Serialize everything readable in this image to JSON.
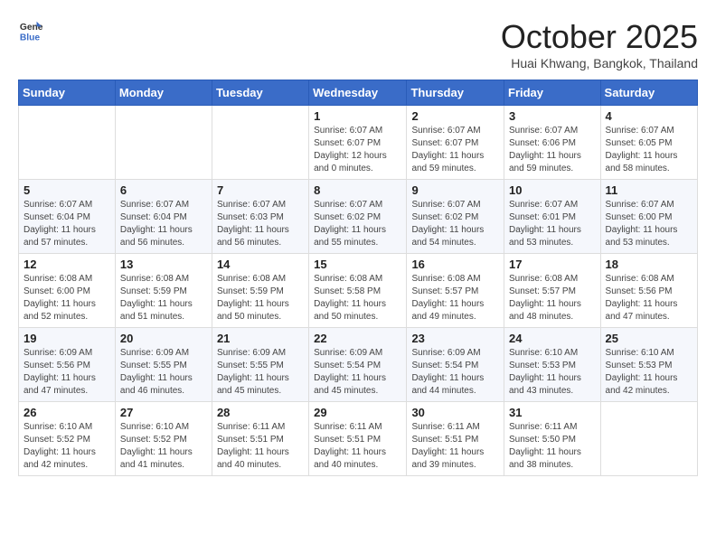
{
  "header": {
    "logo_general": "General",
    "logo_blue": "Blue",
    "month": "October 2025",
    "location": "Huai Khwang, Bangkok, Thailand"
  },
  "weekdays": [
    "Sunday",
    "Monday",
    "Tuesday",
    "Wednesday",
    "Thursday",
    "Friday",
    "Saturday"
  ],
  "weeks": [
    [
      {
        "day": "",
        "info": ""
      },
      {
        "day": "",
        "info": ""
      },
      {
        "day": "",
        "info": ""
      },
      {
        "day": "1",
        "info": "Sunrise: 6:07 AM\nSunset: 6:07 PM\nDaylight: 12 hours\nand 0 minutes."
      },
      {
        "day": "2",
        "info": "Sunrise: 6:07 AM\nSunset: 6:07 PM\nDaylight: 11 hours\nand 59 minutes."
      },
      {
        "day": "3",
        "info": "Sunrise: 6:07 AM\nSunset: 6:06 PM\nDaylight: 11 hours\nand 59 minutes."
      },
      {
        "day": "4",
        "info": "Sunrise: 6:07 AM\nSunset: 6:05 PM\nDaylight: 11 hours\nand 58 minutes."
      }
    ],
    [
      {
        "day": "5",
        "info": "Sunrise: 6:07 AM\nSunset: 6:04 PM\nDaylight: 11 hours\nand 57 minutes."
      },
      {
        "day": "6",
        "info": "Sunrise: 6:07 AM\nSunset: 6:04 PM\nDaylight: 11 hours\nand 56 minutes."
      },
      {
        "day": "7",
        "info": "Sunrise: 6:07 AM\nSunset: 6:03 PM\nDaylight: 11 hours\nand 56 minutes."
      },
      {
        "day": "8",
        "info": "Sunrise: 6:07 AM\nSunset: 6:02 PM\nDaylight: 11 hours\nand 55 minutes."
      },
      {
        "day": "9",
        "info": "Sunrise: 6:07 AM\nSunset: 6:02 PM\nDaylight: 11 hours\nand 54 minutes."
      },
      {
        "day": "10",
        "info": "Sunrise: 6:07 AM\nSunset: 6:01 PM\nDaylight: 11 hours\nand 53 minutes."
      },
      {
        "day": "11",
        "info": "Sunrise: 6:07 AM\nSunset: 6:00 PM\nDaylight: 11 hours\nand 53 minutes."
      }
    ],
    [
      {
        "day": "12",
        "info": "Sunrise: 6:08 AM\nSunset: 6:00 PM\nDaylight: 11 hours\nand 52 minutes."
      },
      {
        "day": "13",
        "info": "Sunrise: 6:08 AM\nSunset: 5:59 PM\nDaylight: 11 hours\nand 51 minutes."
      },
      {
        "day": "14",
        "info": "Sunrise: 6:08 AM\nSunset: 5:59 PM\nDaylight: 11 hours\nand 50 minutes."
      },
      {
        "day": "15",
        "info": "Sunrise: 6:08 AM\nSunset: 5:58 PM\nDaylight: 11 hours\nand 50 minutes."
      },
      {
        "day": "16",
        "info": "Sunrise: 6:08 AM\nSunset: 5:57 PM\nDaylight: 11 hours\nand 49 minutes."
      },
      {
        "day": "17",
        "info": "Sunrise: 6:08 AM\nSunset: 5:57 PM\nDaylight: 11 hours\nand 48 minutes."
      },
      {
        "day": "18",
        "info": "Sunrise: 6:08 AM\nSunset: 5:56 PM\nDaylight: 11 hours\nand 47 minutes."
      }
    ],
    [
      {
        "day": "19",
        "info": "Sunrise: 6:09 AM\nSunset: 5:56 PM\nDaylight: 11 hours\nand 47 minutes."
      },
      {
        "day": "20",
        "info": "Sunrise: 6:09 AM\nSunset: 5:55 PM\nDaylight: 11 hours\nand 46 minutes."
      },
      {
        "day": "21",
        "info": "Sunrise: 6:09 AM\nSunset: 5:55 PM\nDaylight: 11 hours\nand 45 minutes."
      },
      {
        "day": "22",
        "info": "Sunrise: 6:09 AM\nSunset: 5:54 PM\nDaylight: 11 hours\nand 45 minutes."
      },
      {
        "day": "23",
        "info": "Sunrise: 6:09 AM\nSunset: 5:54 PM\nDaylight: 11 hours\nand 44 minutes."
      },
      {
        "day": "24",
        "info": "Sunrise: 6:10 AM\nSunset: 5:53 PM\nDaylight: 11 hours\nand 43 minutes."
      },
      {
        "day": "25",
        "info": "Sunrise: 6:10 AM\nSunset: 5:53 PM\nDaylight: 11 hours\nand 42 minutes."
      }
    ],
    [
      {
        "day": "26",
        "info": "Sunrise: 6:10 AM\nSunset: 5:52 PM\nDaylight: 11 hours\nand 42 minutes."
      },
      {
        "day": "27",
        "info": "Sunrise: 6:10 AM\nSunset: 5:52 PM\nDaylight: 11 hours\nand 41 minutes."
      },
      {
        "day": "28",
        "info": "Sunrise: 6:11 AM\nSunset: 5:51 PM\nDaylight: 11 hours\nand 40 minutes."
      },
      {
        "day": "29",
        "info": "Sunrise: 6:11 AM\nSunset: 5:51 PM\nDaylight: 11 hours\nand 40 minutes."
      },
      {
        "day": "30",
        "info": "Sunrise: 6:11 AM\nSunset: 5:51 PM\nDaylight: 11 hours\nand 39 minutes."
      },
      {
        "day": "31",
        "info": "Sunrise: 6:11 AM\nSunset: 5:50 PM\nDaylight: 11 hours\nand 38 minutes."
      },
      {
        "day": "",
        "info": ""
      }
    ]
  ]
}
